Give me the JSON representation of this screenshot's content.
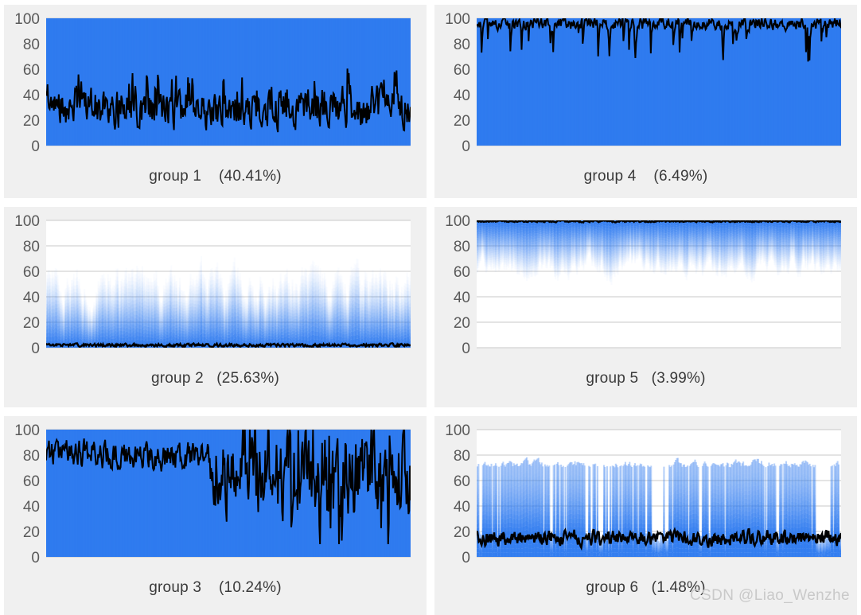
{
  "watermark": "CSDN @Liao_Wenzhe",
  "layout": {
    "columns": 2,
    "rows": 3,
    "panel_background": "#f0f0f0",
    "page_background": "#ffffff",
    "band_color": "#2f7bef",
    "line_color": "#000000",
    "gridline_color": "#c8c8c8",
    "tick_color": "#5a5a5a"
  },
  "panels": [
    {
      "id": "group-1",
      "caption": "group 1    (40.41%)",
      "name": "group 1",
      "percent": "40.41%"
    },
    {
      "id": "group-4",
      "caption": "group 4    (6.49%)",
      "name": "group 4",
      "percent": "6.49%"
    },
    {
      "id": "group-2",
      "caption": "group 2   (25.63%)",
      "name": "group 2",
      "percent": "25.63%"
    },
    {
      "id": "group-5",
      "caption": "group 5   (3.99%)",
      "name": "group 5",
      "percent": "3.99%"
    },
    {
      "id": "group-3",
      "caption": "group 3    (10.24%)",
      "name": "group 3",
      "percent": "10.24%"
    },
    {
      "id": "group-6",
      "caption": "group 6   (1.48%)",
      "name": "group 6",
      "percent": "1.48%"
    }
  ],
  "chart_data": [
    {
      "type": "area",
      "title": "group 1    (40.41%)",
      "xlabel": "",
      "ylabel": "",
      "ylim": [
        0,
        100
      ],
      "yticks": [
        0,
        20,
        40,
        60,
        80,
        100
      ],
      "ytick_labels": [
        "0",
        "20",
        "40",
        "60",
        "80",
        "100"
      ],
      "grid": true,
      "legend": "none",
      "series": [
        {
          "name": "density band",
          "kind": "filled-band",
          "band_low": 0,
          "band_high": 100,
          "fill_opacity_profile": "uniform-strong"
        },
        {
          "name": "median line",
          "kind": "line",
          "mean": 30,
          "min": 3,
          "max": 63,
          "noise": 13,
          "trend": "flat"
        }
      ],
      "annotation": "group 1 occupies 40.41% of samples; median line fluctuates around 25-35 across the whole window"
    },
    {
      "type": "area",
      "title": "group 4    (6.49%)",
      "xlabel": "",
      "ylabel": "",
      "ylim": [
        0,
        100
      ],
      "yticks": [
        0,
        20,
        40,
        60,
        80,
        100
      ],
      "ytick_labels": [
        "0",
        "20",
        "40",
        "60",
        "80",
        "100"
      ],
      "grid": true,
      "legend": "none",
      "series": [
        {
          "name": "density band",
          "kind": "filled-band",
          "band_low": 0,
          "band_high": 100,
          "fill_opacity_profile": "uniform-strong"
        },
        {
          "name": "median line",
          "kind": "line",
          "mean": 95,
          "min": 66,
          "max": 100,
          "noise": 6,
          "trend": "flat-high"
        }
      ],
      "annotation": "group 4 occupies 6.49%; median line pinned near 95-100 with downward spikes to ~66"
    },
    {
      "type": "area",
      "title": "group 2   (25.63%)",
      "xlabel": "",
      "ylabel": "",
      "ylim": [
        0,
        100
      ],
      "yticks": [
        0,
        20,
        40,
        60,
        80,
        100
      ],
      "ytick_labels": [
        "0",
        "20",
        "40",
        "60",
        "80",
        "100"
      ],
      "grid": true,
      "legend": "none",
      "series": [
        {
          "name": "density band",
          "kind": "filled-band",
          "band_low": 0,
          "band_high": 95,
          "fill_opacity_profile": "bottom-heavy-fade"
        },
        {
          "name": "median line",
          "kind": "line",
          "mean": 2,
          "min": 0,
          "max": 5,
          "noise": 1,
          "trend": "flat-low"
        }
      ],
      "annotation": "group 2 occupies 25.63%; median line hugs the 0-3 baseline, density fades from dense near 0 to sparse spikes up to ~95"
    },
    {
      "type": "area",
      "title": "group 5   (3.99%)",
      "xlabel": "",
      "ylabel": "",
      "ylim": [
        0,
        100
      ],
      "yticks": [
        0,
        20,
        40,
        60,
        80,
        100
      ],
      "ytick_labels": [
        "0",
        "20",
        "40",
        "60",
        "80",
        "100"
      ],
      "grid": true,
      "legend": "none",
      "series": [
        {
          "name": "density band",
          "kind": "filled-band",
          "band_low": 38,
          "band_high": 100,
          "fill_opacity_profile": "top-heavy-fade"
        },
        {
          "name": "median line",
          "kind": "line",
          "mean": 99,
          "min": 97,
          "max": 100,
          "noise": 1,
          "trend": "flat-top"
        }
      ],
      "annotation": "group 5 occupies 3.99%; median line sits flat at ~99, density fades downward from 100 to about 38"
    },
    {
      "type": "area",
      "title": "group 3    (10.24%)",
      "xlabel": "",
      "ylabel": "",
      "ylim": [
        0,
        100
      ],
      "yticks": [
        0,
        20,
        40,
        60,
        80,
        100
      ],
      "ytick_labels": [
        "0",
        "20",
        "40",
        "60",
        "80",
        "100"
      ],
      "grid": true,
      "legend": "none",
      "series": [
        {
          "name": "density band",
          "kind": "filled-band",
          "band_low": 0,
          "band_high": 100,
          "fill_opacity_profile": "uniform-strong"
        },
        {
          "name": "median line",
          "kind": "line",
          "mean": 78,
          "min": 10,
          "max": 100,
          "noise": 9,
          "trend": "declining-then-volatile"
        }
      ],
      "annotation": "group 3 occupies 10.24%; median line near 80 in the first half then drops into a volatile 20-100 range in the second half"
    },
    {
      "type": "area",
      "title": "group 6   (1.48%)",
      "xlabel": "",
      "ylabel": "",
      "ylim": [
        0,
        100
      ],
      "yticks": [
        0,
        20,
        40,
        60,
        80,
        100
      ],
      "ytick_labels": [
        "0",
        "20",
        "40",
        "60",
        "80",
        "100"
      ],
      "grid": true,
      "legend": "none",
      "series": [
        {
          "name": "density band",
          "kind": "filled-band",
          "band_low": 0,
          "band_high": 82,
          "fill_opacity_profile": "blocky-gaps"
        },
        {
          "name": "median line",
          "kind": "line",
          "mean": 15,
          "min": 2,
          "max": 30,
          "noise": 5,
          "trend": "flat-low"
        }
      ],
      "annotation": "group 6 occupies 1.48%; median line around 12-20, band reaches ~80 with frequent vertical gaps"
    }
  ]
}
